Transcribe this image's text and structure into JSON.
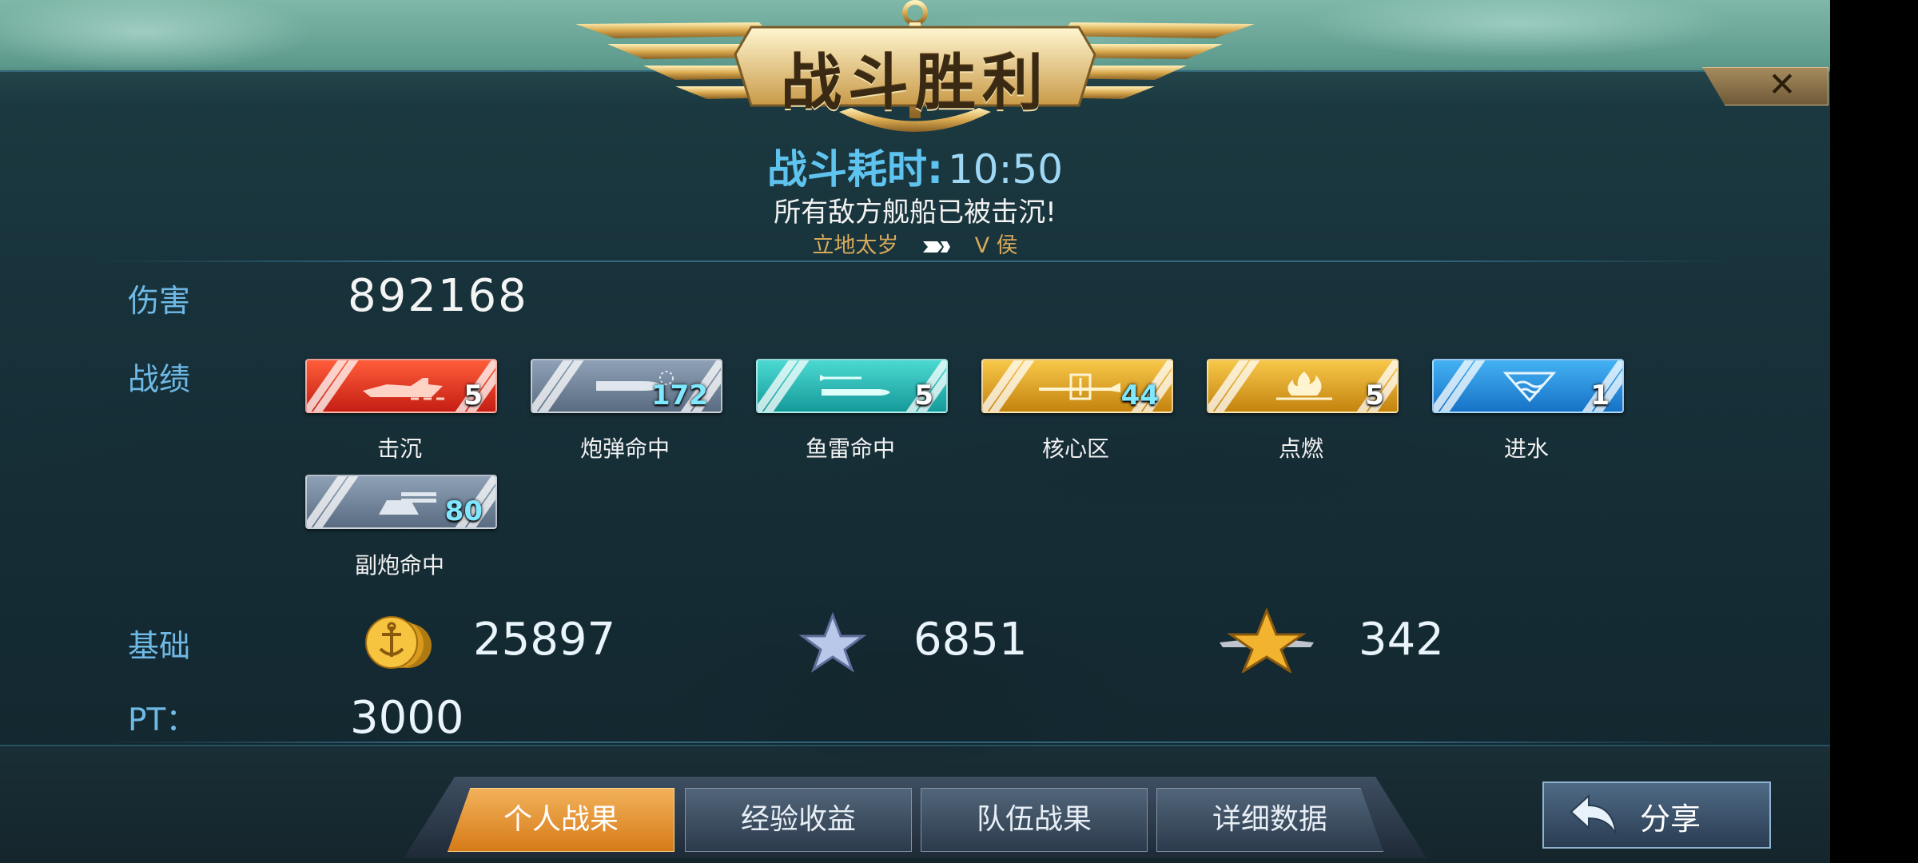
{
  "header": {
    "title": "战斗胜利",
    "duration_label": "战斗耗时:",
    "duration_value": "10:50",
    "subtitle": "所有敌方舰船已被击沉!",
    "player_left": "立地太岁",
    "player_right": "V  侯",
    "close_glyph": "✕"
  },
  "damage": {
    "label": "伤害",
    "value": "892168"
  },
  "record": {
    "label": "战绩",
    "items": [
      {
        "name": "击沉",
        "count": "5",
        "color": "#e2331f",
        "icon": "ship-sink-icon"
      },
      {
        "name": "炮弹命中",
        "count": "172",
        "color": "#6f8298",
        "icon": "shell-icon"
      },
      {
        "name": "鱼雷命中",
        "count": "5",
        "color": "#22b7b3",
        "icon": "torpedo-icon"
      },
      {
        "name": "核心区",
        "count": "44",
        "color": "#e0a21c",
        "icon": "core-zone-icon"
      },
      {
        "name": "点燃",
        "count": "5",
        "color": "#e0a21c",
        "icon": "fire-icon"
      },
      {
        "name": "进水",
        "count": "1",
        "color": "#2a8fe0",
        "icon": "flooding-icon"
      },
      {
        "name": "副炮命中",
        "count": "80",
        "color": "#6f8298",
        "icon": "secondary-gun-icon"
      }
    ]
  },
  "base": {
    "label": "基础",
    "gold": "25897",
    "star": "6851",
    "medal": "342"
  },
  "pt": {
    "label": "PT：",
    "value": "3000"
  },
  "tabs": [
    "个人战果",
    "经验收益",
    "队伍战果",
    "详细数据"
  ],
  "share": {
    "label": "分享"
  }
}
